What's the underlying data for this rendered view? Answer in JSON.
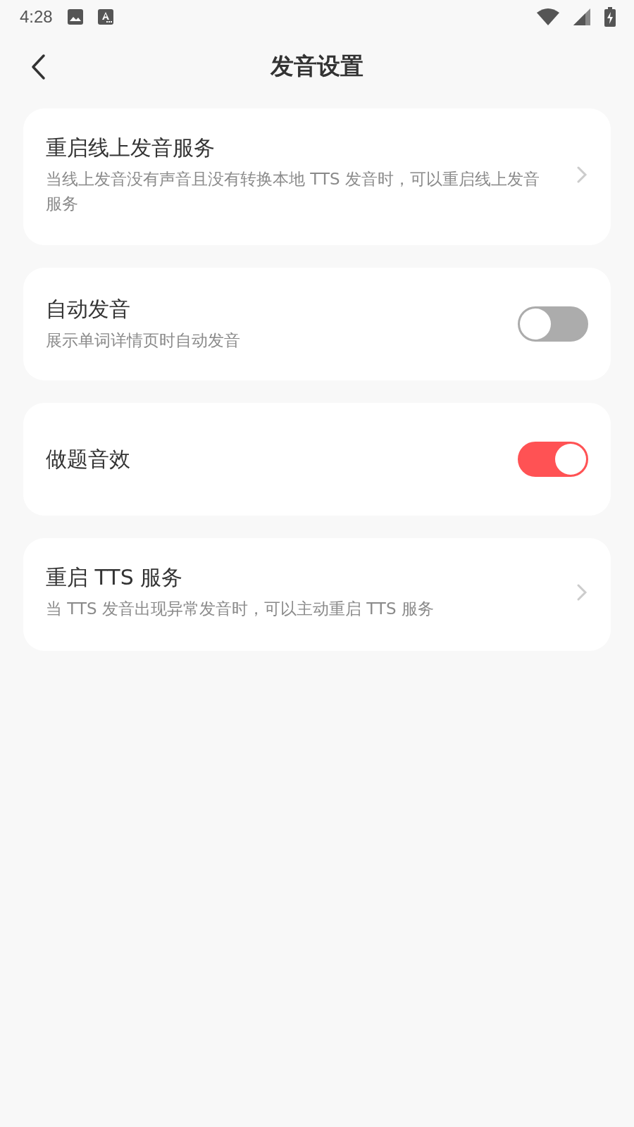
{
  "status_bar": {
    "time": "4:28"
  },
  "header": {
    "title": "发音设置"
  },
  "items": [
    {
      "kind": "link",
      "title": "重启线上发音服务",
      "description": "当线上发音没有声音且没有转换本地 TTS 发音时，可以重启线上发音服务"
    },
    {
      "kind": "toggle",
      "title": "自动发音",
      "description": "展示单词详情页时自动发音",
      "on": false
    },
    {
      "kind": "toggle",
      "title": "做题音效",
      "on": true
    },
    {
      "kind": "link",
      "title": "重启 TTS 服务",
      "description": "当 TTS 发音出现异常发音时，可以主动重启 TTS 服务"
    }
  ]
}
